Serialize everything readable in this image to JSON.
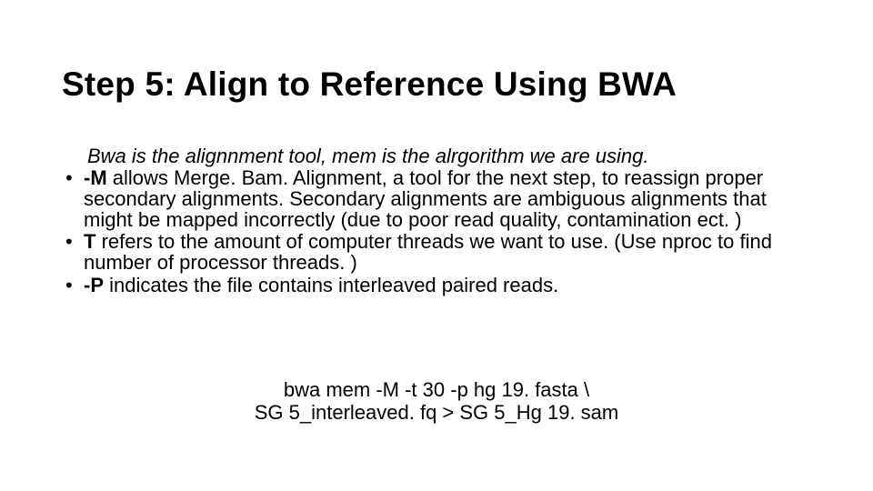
{
  "title": "Step 5:  Align to Reference Using BWA",
  "intro": "Bwa is the alignnment tool, mem is the alrgorithm we are using.",
  "bullets": {
    "b1": {
      "opt": "-M",
      "text": " allows Merge. Bam. Alignment, a tool for the next step, to reassign proper secondary alignments.  Secondary alignments are ambiguous alignments that might be mapped incorrectly (due to poor read quality, contamination ect. )"
    },
    "b2": {
      "opt": "T",
      "text": " refers to the amount of computer threads we want to use.  (Use nproc to find number of processor threads. )"
    },
    "b3": {
      "opt": "-P",
      "text": " indicates the file contains interleaved paired reads."
    }
  },
  "command": {
    "line1": "bwa mem -M -t 30 -p hg 19. fasta \\",
    "line2": "SG 5_interleaved. fq > SG 5_Hg 19. sam"
  }
}
